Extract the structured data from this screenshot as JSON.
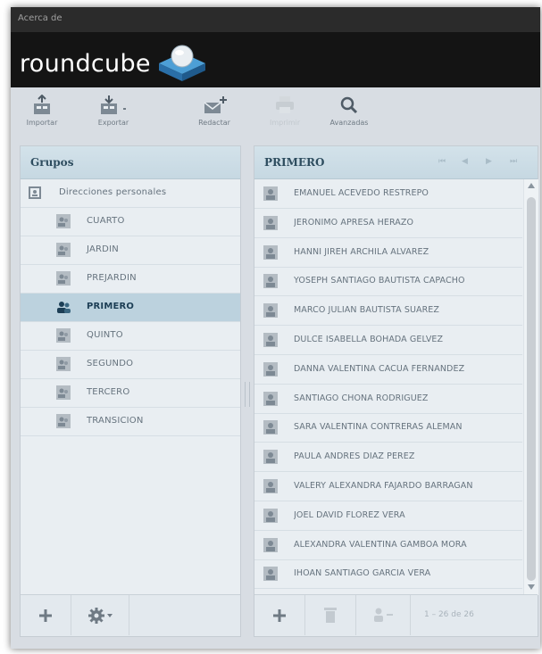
{
  "window": {
    "title": "Acerca de"
  },
  "brand": {
    "name": "roundcube"
  },
  "toolbar": {
    "import_label": "Importar",
    "export_label": "Exportar",
    "compose_label": "Redactar",
    "print_label": "Imprimir",
    "advanced_label": "Avanzadas"
  },
  "groups": {
    "header": "Grupos",
    "root": "Direcciones personales",
    "items": [
      "CUARTO",
      "JARDIN",
      "PREJARDIN",
      "PRIMERO",
      "QUINTO",
      "SEGUNDO",
      "TERCERO",
      "TRANSICION"
    ],
    "selected": "PRIMERO"
  },
  "contacts": {
    "header": "PRIMERO",
    "nav": [
      "⏮",
      "◀",
      "▶",
      "⏭"
    ],
    "items": [
      "EMANUEL ACEVEDO RESTREPO",
      "JERONIMO APRESA HERAZO",
      "HANNI JIREH ARCHILA ALVAREZ",
      "YOSEPH SANTIAGO BAUTISTA CAPACHO",
      "MARCO JULIAN BAUTISTA SUAREZ",
      "DULCE ISABELLA BOHADA GELVEZ",
      "DANNA VALENTINA CACUA FERNANDEZ",
      "SANTIAGO CHONA RODRIGUEZ",
      "SARA VALENTINA CONTRERAS ALEMAN",
      "PAULA ANDRES DIAZ PEREZ",
      "VALERY ALEXANDRA FAJARDO BARRAGAN",
      "JOEL DAVID FLOREZ VERA",
      "ALEXANDRA VALENTINA GAMBOA MORA",
      "IHOAN SANTIAGO GARCIA VERA"
    ],
    "count": "1 – 26 de 26"
  },
  "colors": {
    "accent": "#2e4d5f",
    "selected": "#bcd2de",
    "header_bg": "#141414"
  }
}
